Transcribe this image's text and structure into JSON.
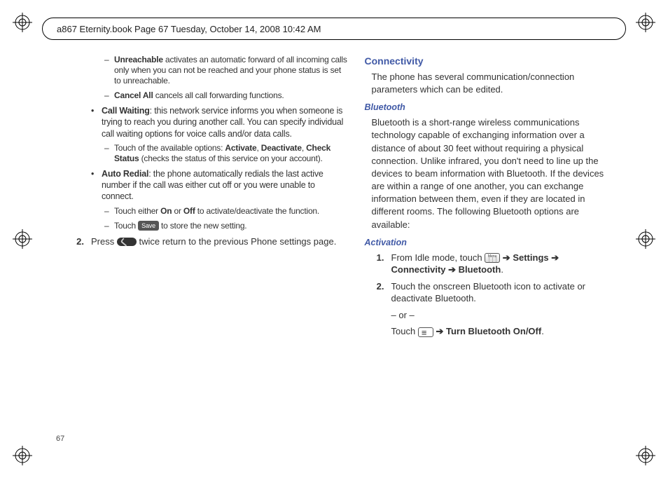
{
  "header": "a867 Eternity.book  Page 67  Tuesday, October 14, 2008  10:42 AM",
  "page_number": "67",
  "left": {
    "unreachable_b": "Unreachable",
    "unreachable_t": " activates an automatic forward of all incoming calls only when you can not be reached and your phone status is set to unreachable.",
    "cancel_b": "Cancel All",
    "cancel_t": " cancels all call forwarding functions.",
    "waiting_b": "Call Waiting",
    "waiting_t": ": this network service informs you when someone is trying to reach you during another call. You can specify individual call waiting options for voice calls and/or data calls.",
    "waiting_sub_pre": "Touch of the available options: ",
    "waiting_sub_a": "Activate",
    "waiting_sub_d": "Deactivate",
    "waiting_sub_c": "Check Status",
    "waiting_sub_post": " (checks the status of this service on your account).",
    "redial_b": "Auto Redial",
    "redial_t": ": the phone automatically redials the last active number if the call was either cut off or you were unable to connect.",
    "redial_sub1_pre": "Touch either ",
    "redial_sub1_on": "On",
    "redial_sub1_mid": " or ",
    "redial_sub1_off": "Off",
    "redial_sub1_post": " to activate/deactivate the function.",
    "redial_sub2_pre": "Touch ",
    "redial_sub2_post": " to store the new setting.",
    "save_label": "Save",
    "num2": "2.",
    "num2_pre": "Press ",
    "num2_post": " twice return to the previous Phone settings page."
  },
  "right": {
    "h_conn": "Connectivity",
    "conn_para": "The phone has several communication/connection parameters which can be edited.",
    "h_bt": "Bluetooth",
    "bt_para": "Bluetooth is a short-range wireless communications technology capable of exchanging information over a distance of about 30 feet without requiring a physical connection. Unlike infrared, you don't need to line up the devices to beam information with Bluetooth. If the devices are within a range of one another, you can exchange information between them, even if they are located in different rooms. The following Bluetooth options are available:",
    "h_act": "Activation",
    "n1": "1.",
    "n1_pre": "From Idle mode, touch ",
    "n1_settings": "Settings",
    "n1_conn": "Connectivity",
    "n1_bt": "Bluetooth",
    "n2": "2.",
    "n2_t": "Touch the onscreen Bluetooth icon to activate or deactivate Bluetooth.",
    "or": "– or –",
    "touch_pre": "Touch ",
    "touch_b": "Turn Bluetooth On/Off",
    "arrow": "➔",
    "comma": ", ",
    "period": "."
  }
}
